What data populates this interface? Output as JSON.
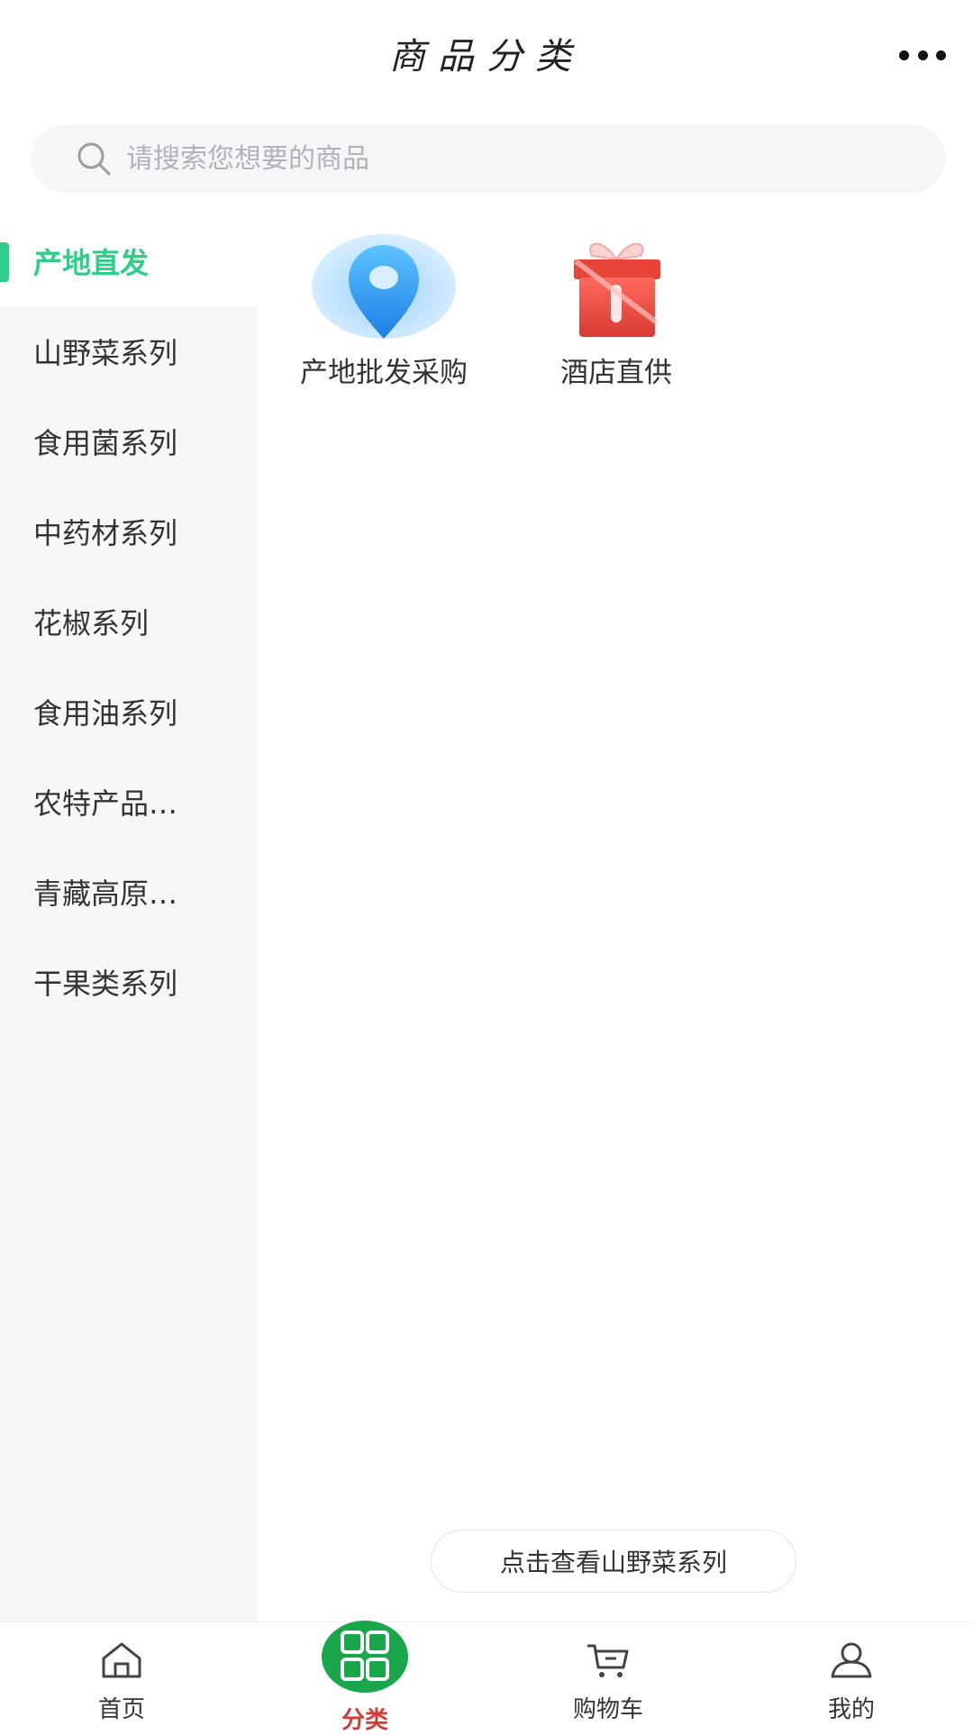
{
  "header": {
    "title": "商品分类",
    "more_icon": "more-dots-icon"
  },
  "search": {
    "placeholder": "请搜索您想要的商品",
    "icon": "search-icon"
  },
  "categories": [
    {
      "label": "产地直发",
      "active": true
    },
    {
      "label": "山野菜系列"
    },
    {
      "label": "食用菌系列"
    },
    {
      "label": "中药材系列"
    },
    {
      "label": "花椒系列"
    },
    {
      "label": "食用油系列"
    },
    {
      "label": "农特产品…"
    },
    {
      "label": "青藏高原…"
    },
    {
      "label": "干果类系列"
    }
  ],
  "subcategories": [
    {
      "label": "产地批发采购",
      "icon": "location-pin-icon"
    },
    {
      "label": "酒店直供",
      "icon": "gift-box-icon"
    }
  ],
  "see_more": {
    "label": "点击查看山野菜系列"
  },
  "tabbar": {
    "tabs": [
      {
        "label": "首页",
        "icon": "home-icon"
      },
      {
        "label": "分类",
        "icon": "category-grid-icon",
        "active": true
      },
      {
        "label": "购物车",
        "icon": "cart-icon"
      },
      {
        "label": "我的",
        "icon": "user-icon"
      }
    ]
  },
  "colors": {
    "accent": "#2fcf8a",
    "active_tab": "#d13b3b",
    "category_bubble": "#1aa64a"
  }
}
